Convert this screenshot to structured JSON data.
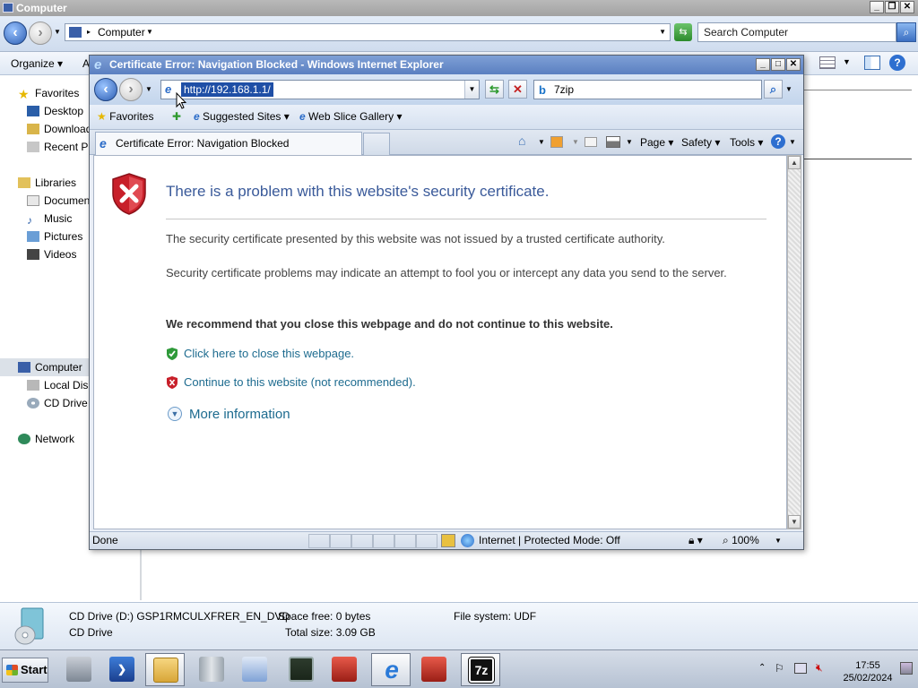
{
  "explorer": {
    "window_title": "Computer",
    "address_crumb": "Computer",
    "search_placeholder": "Search Computer",
    "toolbar": {
      "organize": "Organize",
      "extra": "A"
    },
    "nav": {
      "favorites": "Favorites",
      "desktop": "Desktop",
      "downloads": "Download",
      "recent": "Recent Pl",
      "libraries": "Libraries",
      "documents": "Document",
      "music": "Music",
      "pictures": "Pictures",
      "videos": "Videos",
      "computer": "Computer",
      "local_disk": "Local Disk",
      "cd_drive": "CD Drive (",
      "network": "Network"
    },
    "details": {
      "name": "CD Drive (D:) GSP1RMCULXFRER_EN_DVD",
      "type": "CD Drive",
      "space_free_label": "Space free:",
      "space_free": "0 bytes",
      "total_size_label": "Total size:",
      "total_size": "3.09 GB",
      "fs_label": "File system:",
      "fs": "UDF"
    }
  },
  "ie": {
    "window_title": "Certificate Error: Navigation Blocked - Windows Internet Explorer",
    "url": "http://192.168.1.1/",
    "search_text": "7zip",
    "favorites": "Favorites",
    "suggested_sites": "Suggested Sites",
    "web_slice_gallery": "Web Slice Gallery",
    "tab_title": "Certificate Error: Navigation Blocked",
    "commands": {
      "page": "Page",
      "safety": "Safety",
      "tools": "Tools"
    },
    "content": {
      "title": "There is a problem with this website's security certificate.",
      "p1": "The security certificate presented by this website was not issued by a trusted certificate authority.",
      "p2": "Security certificate problems may indicate an attempt to fool you or intercept any data you send to the server.",
      "recommend": "We recommend that you close this webpage and do not continue to this website.",
      "close_link": "Click here to close this webpage.",
      "continue_link": "Continue to this website (not recommended).",
      "more_info": "More information"
    },
    "status": {
      "left": "Done",
      "zone": "Internet | Protected Mode: Off",
      "zoom": "100%"
    }
  },
  "taskbar": {
    "start": "Start",
    "time": "17:55",
    "date": "25/02/2024"
  }
}
